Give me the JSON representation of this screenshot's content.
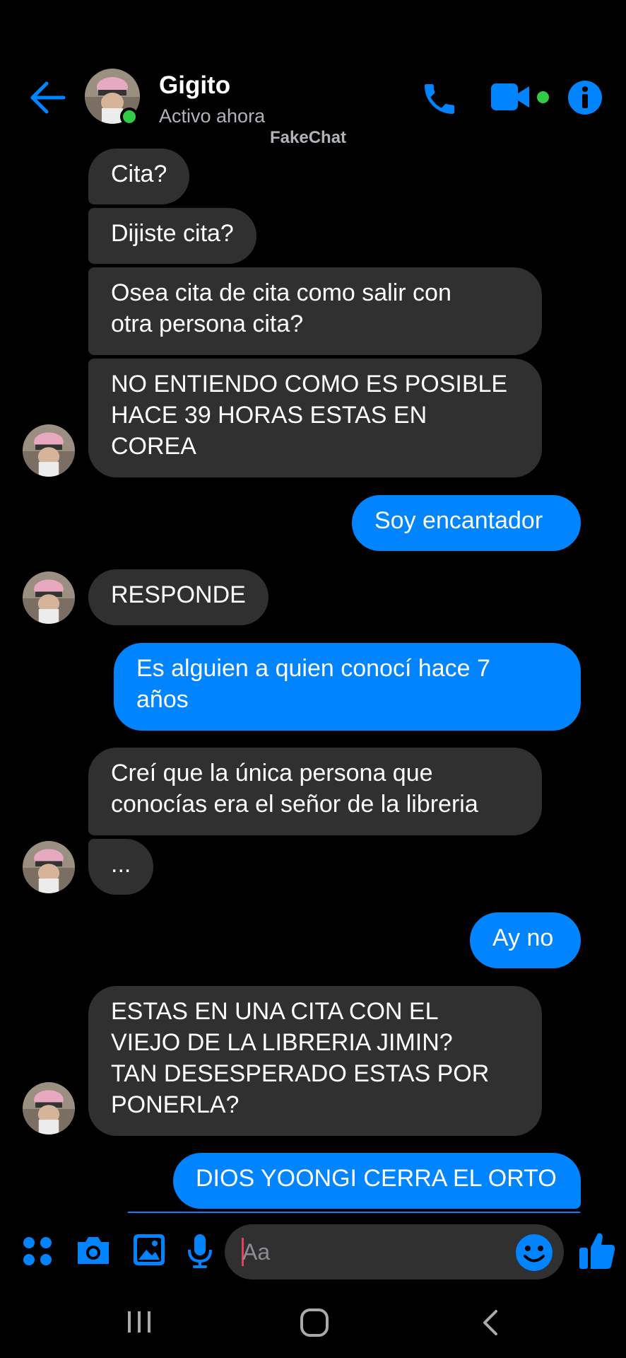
{
  "header": {
    "contact_name": "Gigito",
    "status": "Activo ahora",
    "watermark": "FakeChat",
    "icons": [
      "back-arrow-icon",
      "phone-icon",
      "video-camera-icon",
      "info-icon"
    ],
    "accent_color": "#0084ff",
    "online_color": "#31cc46"
  },
  "messages": [
    {
      "dir": "in",
      "text": "Cita?"
    },
    {
      "dir": "in",
      "text": "Dijiste cita?"
    },
    {
      "dir": "in",
      "text": "Osea cita de cita como salir con\notra persona cita?"
    },
    {
      "dir": "in",
      "text": "NO ENTIENDO COMO ES POSIBLE\nHACE 39 HORAS ESTAS EN\nCOREA"
    },
    {
      "dir": "out",
      "text": "Soy encantador"
    },
    {
      "dir": "in",
      "text": "RESPONDE"
    },
    {
      "dir": "out",
      "text": "Es alguien a quien conocí hace 7\naños"
    },
    {
      "dir": "in",
      "text": "Creí que la única persona que\nconocías era el señor de la libreria"
    },
    {
      "dir": "in",
      "text": "..."
    },
    {
      "dir": "out",
      "text": "Ay no"
    },
    {
      "dir": "in",
      "text": "ESTAS EN UNA CITA CON EL\nVIEJO DE LA LIBRERIA JIMIN?\nTAN DESESPERADO ESTAS POR\nPONERLA?"
    },
    {
      "dir": "out",
      "text": "DIOS YOONGI CERRA EL ORTO"
    }
  ],
  "composer": {
    "placeholder": "Aa",
    "icons": [
      "apps-grid-icon",
      "camera-icon",
      "image-icon",
      "microphone-icon",
      "emoji-icon",
      "thumbs-up-icon"
    ]
  },
  "navbar": {
    "icons": [
      "recent-apps-icon",
      "home-icon",
      "back-icon"
    ]
  },
  "colors": {
    "incoming_bubble": "#303030",
    "outgoing_bubble": "#0084ff",
    "background": "#000000"
  }
}
